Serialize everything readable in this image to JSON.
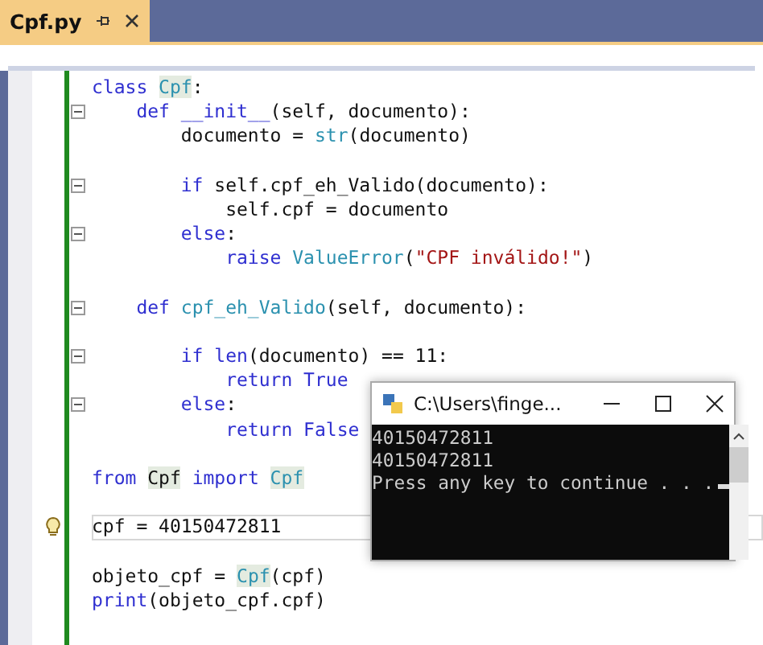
{
  "tabs": [
    {
      "label": "Cpf.py",
      "selected": true
    }
  ],
  "code_lines": [
    {
      "fold": false,
      "current": false,
      "segments": [
        {
          "text": "class ",
          "kind": "kw"
        },
        {
          "text": "Cpf",
          "kind": "type",
          "highlight": true
        },
        {
          "text": ":",
          "kind": "plain"
        }
      ]
    },
    {
      "fold": true,
      "current": false,
      "segments": [
        {
          "text": "    def ",
          "kind": "kw"
        },
        {
          "text": "__init__",
          "kind": "kw"
        },
        {
          "text": "(self, documento):",
          "kind": "plain"
        }
      ]
    },
    {
      "fold": false,
      "current": false,
      "segments": [
        {
          "text": "        documento = ",
          "kind": "plain"
        },
        {
          "text": "str",
          "kind": "type"
        },
        {
          "text": "(documento)",
          "kind": "plain"
        }
      ]
    },
    {
      "fold": false,
      "current": false
    },
    {
      "fold": true,
      "current": false,
      "segments": [
        {
          "text": "        if ",
          "kind": "kw"
        },
        {
          "text": "self.cpf_eh_Valido(documento):",
          "kind": "plain"
        }
      ]
    },
    {
      "fold": false,
      "current": false,
      "segments": [
        {
          "text": "            self.cpf = documento",
          "kind": "plain"
        }
      ]
    },
    {
      "fold": true,
      "current": false,
      "segments": [
        {
          "text": "        else",
          "kind": "kw"
        },
        {
          "text": ":",
          "kind": "plain"
        }
      ]
    },
    {
      "fold": false,
      "current": false,
      "segments": [
        {
          "text": "            raise ",
          "kind": "kw"
        },
        {
          "text": "ValueError",
          "kind": "type"
        },
        {
          "text": "(",
          "kind": "plain"
        },
        {
          "text": "\"CPF inválido!\"",
          "kind": "str"
        },
        {
          "text": ")",
          "kind": "plain"
        }
      ]
    },
    {
      "fold": false,
      "current": false
    },
    {
      "fold": true,
      "current": false,
      "segments": [
        {
          "text": "    def ",
          "kind": "kw"
        },
        {
          "text": "cpf_eh_Valido",
          "kind": "type"
        },
        {
          "text": "(self, documento):",
          "kind": "plain"
        }
      ]
    },
    {
      "fold": false,
      "current": false
    },
    {
      "fold": true,
      "current": false,
      "segments": [
        {
          "text": "        if ",
          "kind": "kw"
        },
        {
          "text": "len",
          "kind": "kw"
        },
        {
          "text": "(documento) == 11:",
          "kind": "plain"
        }
      ]
    },
    {
      "fold": false,
      "current": false,
      "segments": [
        {
          "text": "            return True",
          "kind": "kw"
        }
      ]
    },
    {
      "fold": true,
      "current": false,
      "segments": [
        {
          "text": "        else",
          "kind": "kw"
        },
        {
          "text": ":",
          "kind": "plain"
        }
      ]
    },
    {
      "fold": false,
      "current": false,
      "segments": [
        {
          "text": "            return False",
          "kind": "kw"
        }
      ]
    },
    {
      "fold": false,
      "current": false
    },
    {
      "fold": false,
      "current": false,
      "segments": [
        {
          "text": "from ",
          "kind": "kw"
        },
        {
          "text": "Cpf",
          "kind": "plain",
          "highlight": true
        },
        {
          "text": " import ",
          "kind": "kw"
        },
        {
          "text": "Cpf",
          "kind": "type",
          "highlight": true
        }
      ]
    },
    {
      "fold": false,
      "current": false
    },
    {
      "fold": false,
      "current": true,
      "segments": [
        {
          "text": "cpf = 40150472811",
          "kind": "plain"
        }
      ]
    },
    {
      "fold": false,
      "current": false
    },
    {
      "fold": false,
      "current": false,
      "segments": [
        {
          "text": "objeto_cpf = ",
          "kind": "plain"
        },
        {
          "text": "Cpf",
          "kind": "type",
          "highlight": true
        },
        {
          "text": "(cpf)",
          "kind": "plain"
        }
      ]
    },
    {
      "fold": false,
      "current": false,
      "segments": [
        {
          "text": "print",
          "kind": "kw"
        },
        {
          "text": "(objeto_cpf.cpf)",
          "kind": "plain"
        }
      ]
    }
  ],
  "console": {
    "title": "C:\\Users\\finge...",
    "lines": [
      "40150472811",
      "40150472811",
      "Press any key to continue . . ."
    ]
  }
}
